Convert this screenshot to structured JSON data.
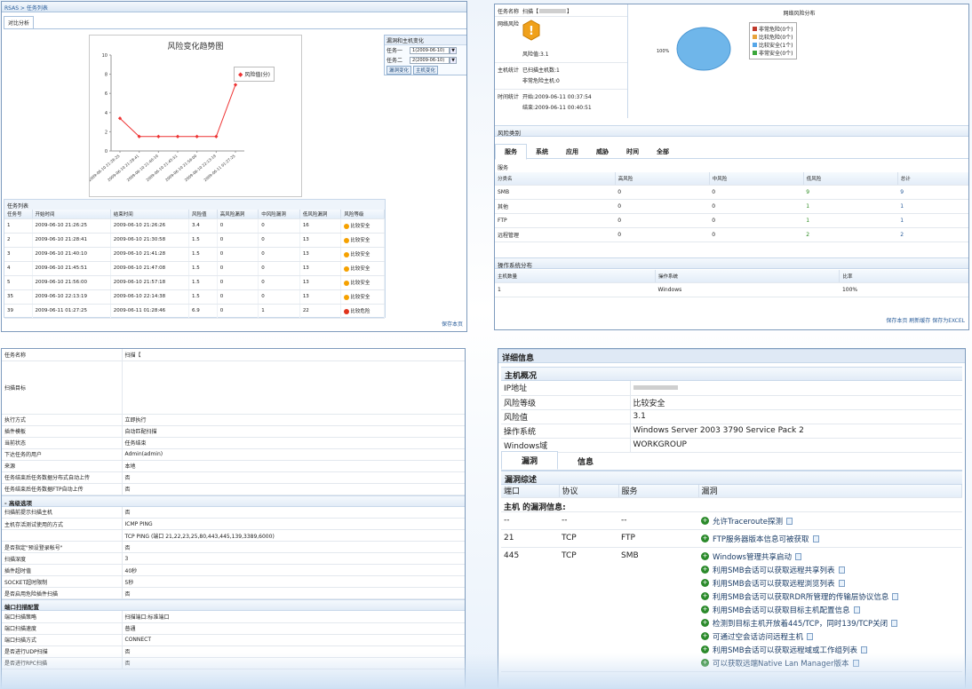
{
  "p1": {
    "breadcrumb": "RSAS > 任务列表",
    "tab": "对比分析",
    "chart_data": {
      "type": "line",
      "title": "风险变化趋势图",
      "categories": [
        "2009-06-10 21:26:25",
        "2009-06-10 21:28:41",
        "2009-06-10 21:40:10",
        "2009-06-10 21:45:51",
        "2009-06-10 21:56:00",
        "2009-06-10 22:13:19",
        "2009-06-11 01:27:25"
      ],
      "series": [
        {
          "name": "风险值(分)",
          "values": [
            3.4,
            1.5,
            1.5,
            1.5,
            1.5,
            1.5,
            6.9
          ]
        }
      ],
      "ylim": [
        0,
        10
      ],
      "yticks": [
        "0",
        "2",
        "4",
        "6",
        "8",
        "10"
      ],
      "xticklabels": [
        "2009-06-10 21:26:25",
        "2009-06-10 21:28:41",
        "2009-06-10 21:40:10",
        "2009-06-10 21:45:51",
        "2009-06-10 21:56:00",
        "2009-06-10 22:13:19",
        "2009-06-11 01:27:25"
      ]
    },
    "compare": {
      "title": "漏洞和主机变化",
      "row1_label": "任务一",
      "row1_value": "1(2009-06-10)",
      "row2_label": "任务二",
      "row2_value": "2(2009-06-10)",
      "btn1": "漏洞变化",
      "btn2": "主机变化"
    },
    "list_title": "任务列表",
    "headers": [
      "任务号",
      "开始时间",
      "结束时间",
      "风险值",
      "高风险漏洞",
      "中风险漏洞",
      "低风险漏洞",
      "风险等级"
    ],
    "rows": [
      [
        "1",
        "2009-06-10 21:26:25",
        "2009-06-10 21:26:26",
        "3.4",
        "0",
        "0",
        "16",
        "比较安全"
      ],
      [
        "2",
        "2009-06-10 21:28:41",
        "2009-06-10 21:30:58",
        "1.5",
        "0",
        "0",
        "13",
        "比较安全"
      ],
      [
        "3",
        "2009-06-10 21:40:10",
        "2009-06-10 21:41:28",
        "1.5",
        "0",
        "0",
        "13",
        "比较安全"
      ],
      [
        "4",
        "2009-06-10 21:45:51",
        "2009-06-10 21:47:08",
        "1.5",
        "0",
        "0",
        "13",
        "比较安全"
      ],
      [
        "5",
        "2009-06-10 21:56:00",
        "2009-06-10 21:57:18",
        "1.5",
        "0",
        "0",
        "13",
        "比较安全"
      ],
      [
        "35",
        "2009-06-10 22:13:19",
        "2009-06-10 22:14:38",
        "1.5",
        "0",
        "0",
        "13",
        "比较安全"
      ],
      [
        "39",
        "2009-06-11 01:27:25",
        "2009-06-11 01:28:46",
        "6.9",
        "0",
        "1",
        "22",
        "比较危险"
      ]
    ],
    "save": "保存本页"
  },
  "p2": {
    "task_name_label": "任务名称",
    "task_name_value": "扫描【",
    "net_risk_label": "网络风险",
    "risk_value_text": "风险值:3.1",
    "dist_title": "网络风险分布",
    "pie_label": "100%",
    "legend": [
      "非常危险(0个)",
      "比较危险(0个)",
      "比较安全(1个)",
      "非常安全(0个)"
    ],
    "legend_colors": [
      "#c0392b",
      "#e8a33a",
      "#55a6e8",
      "#3aa63a"
    ],
    "host_label": "主机统计",
    "host_scanned": "已扫描主机数:1",
    "host_danger": "非常危险主机:0",
    "time_label": "时间统计",
    "time_start": "开始:2009-06-11 00:37:54",
    "time_end": "结束:2009-06-11 00:40:51",
    "risk_class": "风险类别",
    "tabs": [
      "服务",
      "系统",
      "应用",
      "威胁",
      "时间",
      "全部"
    ],
    "service_title": "服务",
    "headers": [
      "分类名",
      "高风险",
      "中风险",
      "低风险",
      "总计"
    ],
    "rows": [
      [
        "SMB",
        "0",
        "0",
        "9",
        "9"
      ],
      [
        "其他",
        "0",
        "0",
        "1",
        "1"
      ],
      [
        "FTP",
        "0",
        "0",
        "1",
        "1"
      ],
      [
        "远程管理",
        "0",
        "0",
        "2",
        "2"
      ]
    ],
    "os_title": "操作系统分布",
    "os_headers": [
      "主机数量",
      "操作系统",
      "比率"
    ],
    "os_rows": [
      [
        "1",
        "Windows",
        "100%"
      ]
    ],
    "footer": "保存本页 刷新缓存 保存为EXCEL"
  },
  "p3": {
    "rows": [
      [
        "任务名称",
        "扫描【"
      ],
      [
        "扫描目标",
        ""
      ],
      [
        "执行方式",
        "立即执行"
      ],
      [
        "插件模板",
        "自动匹配扫描"
      ],
      [
        "当前状态",
        "任务结束"
      ],
      [
        "下达任务的用户",
        "Admin(admin)"
      ],
      [
        "来源",
        "本地"
      ],
      [
        "任务结束后任务数据分布式自动上传",
        "否"
      ],
      [
        "任务结束后任务数据FTP自动上传",
        "否"
      ]
    ],
    "adv": "- 高级选项",
    "rows2": [
      [
        "扫描前提示扫描主机",
        "否"
      ],
      [
        "主机存活测试使用的方式",
        "ICMP PING"
      ],
      [
        "",
        "TCP PING (端口 21,22,23,25,80,443,445,139,3389,6000)"
      ],
      [
        "是否指定\"预设登录帐号\"",
        "否"
      ],
      [
        "扫描深度",
        "3"
      ],
      [
        "插件超时值",
        "40秒"
      ],
      [
        "SOCKET超时限制",
        "5秒"
      ],
      [
        "是否启用危险插件扫描",
        "否"
      ]
    ],
    "port_section": "端口扫描配置",
    "rows3": [
      [
        "端口扫描策略",
        "扫描端口:标准端口"
      ],
      [
        "端口扫描速度",
        "普通"
      ],
      [
        "端口扫描方式",
        "CONNECT"
      ],
      [
        "是否进行UDP扫描",
        "否"
      ],
      [
        "是否进行RPC扫描",
        "否"
      ]
    ]
  },
  "p4": {
    "title": "详细信息",
    "host_title": "主机概况",
    "kv": [
      [
        "IP地址",
        ""
      ],
      [
        "风险等级",
        "比较安全"
      ],
      [
        "风险值",
        "3.1"
      ],
      [
        "操作系统",
        "Windows Server 2003 3790 Service Pack 2"
      ],
      [
        "Windows域",
        "WORKGROUP"
      ]
    ],
    "tabs": [
      "漏洞",
      "信息"
    ],
    "vuln_title": "漏洞综述",
    "headers": [
      "端口",
      "协议",
      "服务",
      "漏洞"
    ],
    "host_line": "主机                        的漏洞信息:",
    "rows": [
      {
        "port": "--",
        "proto": "--",
        "svc": "--",
        "items": [
          "允许Traceroute探测"
        ]
      },
      {
        "port": "21",
        "proto": "TCP",
        "svc": "FTP",
        "items": [
          "FTP服务器版本信息可被获取"
        ]
      },
      {
        "port": "445",
        "proto": "TCP",
        "svc": "SMB",
        "items": [
          "Windows管理共享启动",
          "利用SMB会话可以获取远程共享列表",
          "利用SMB会话可以获取远程浏览列表",
          "利用SMB会话可以获取RDR所管理的传输层协议信息",
          "利用SMB会话可以获取目标主机配置信息",
          "检测到目标主机开放着445/TCP，同时139/TCP关闭",
          "可通过空会话访问远程主机",
          "利用SMB会话可以获取远程域或工作组列表",
          "可以获取远端Native Lan Manager版本"
        ]
      }
    ]
  }
}
